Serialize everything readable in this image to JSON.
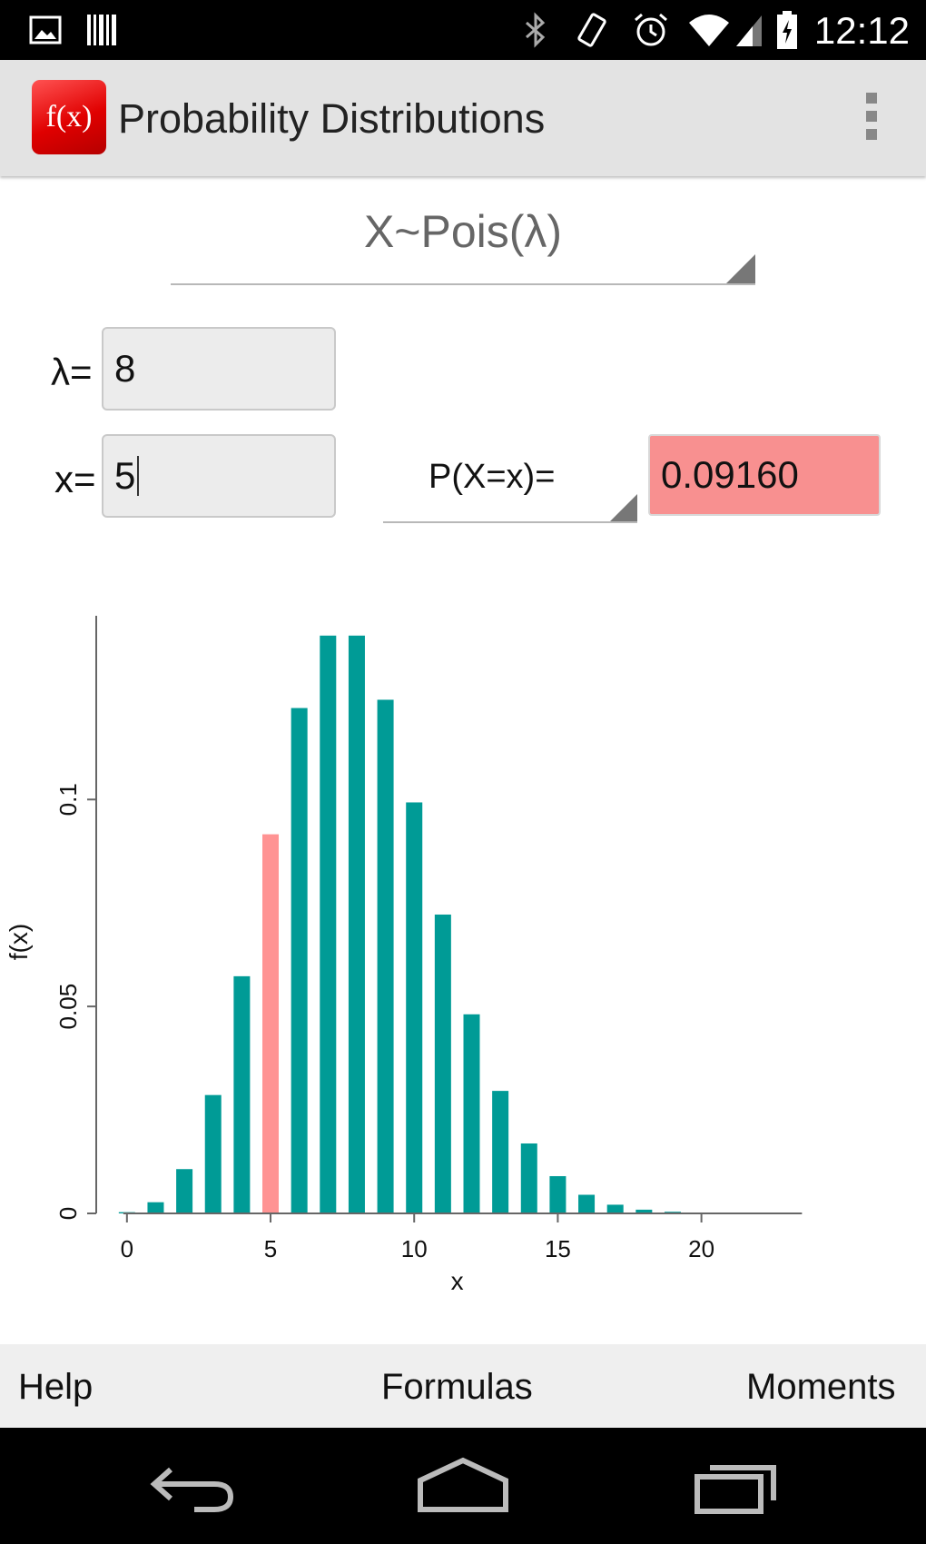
{
  "status_bar": {
    "time": "12:12",
    "icons": [
      "image-icon",
      "barcode-icon",
      "bluetooth-icon",
      "vibrate-icon",
      "alarm-icon",
      "wifi-icon",
      "signal-icon",
      "battery-charging-icon"
    ]
  },
  "action_bar": {
    "app_icon_text": "f(x)",
    "title": "Probability Distributions",
    "overflow_icon": "overflow-menu-icon"
  },
  "distribution_select": {
    "value": "X~Pois(λ)"
  },
  "params": {
    "lambda_label": "λ=",
    "lambda_value": "8",
    "x_label": "x=",
    "x_value": "5"
  },
  "probability_select": {
    "value": "P(X=x)="
  },
  "result": {
    "value": "0.09160"
  },
  "colors": {
    "bar": "#009b96",
    "highlight": "#ff9393",
    "result_bg": "#f89090"
  },
  "chart_data": {
    "type": "bar",
    "xlabel": "x",
    "ylabel": "f(x)",
    "x": [
      0,
      1,
      2,
      3,
      4,
      5,
      6,
      7,
      8,
      9,
      10,
      11,
      12,
      13,
      14,
      15,
      16,
      17,
      18,
      19,
      20,
      21,
      22,
      23
    ],
    "values": [
      0.0003,
      0.0027,
      0.0107,
      0.0286,
      0.0573,
      0.0916,
      0.1221,
      0.1396,
      0.1396,
      0.1241,
      0.0993,
      0.0722,
      0.0481,
      0.0296,
      0.0169,
      0.009,
      0.0045,
      0.0021,
      0.0009,
      0.0004,
      0.0002,
      0.0001,
      0.0,
      0.0
    ],
    "highlight_x": 5,
    "x_ticks": [
      "0",
      "5",
      "10",
      "15",
      "20"
    ],
    "x_tick_values": [
      0,
      5,
      10,
      15,
      20
    ],
    "y_ticks": [
      "0",
      "0.05",
      "0.1"
    ],
    "y_tick_values": [
      0,
      0.05,
      0.1
    ],
    "xlim": [
      -0.5,
      24.5
    ],
    "ylim": [
      0,
      0.14
    ]
  },
  "bottom_buttons": {
    "help": "Help",
    "formulas": "Formulas",
    "moments": "Moments"
  },
  "nav_bar": {
    "icons": [
      "back-icon",
      "home-icon",
      "recents-icon"
    ]
  }
}
